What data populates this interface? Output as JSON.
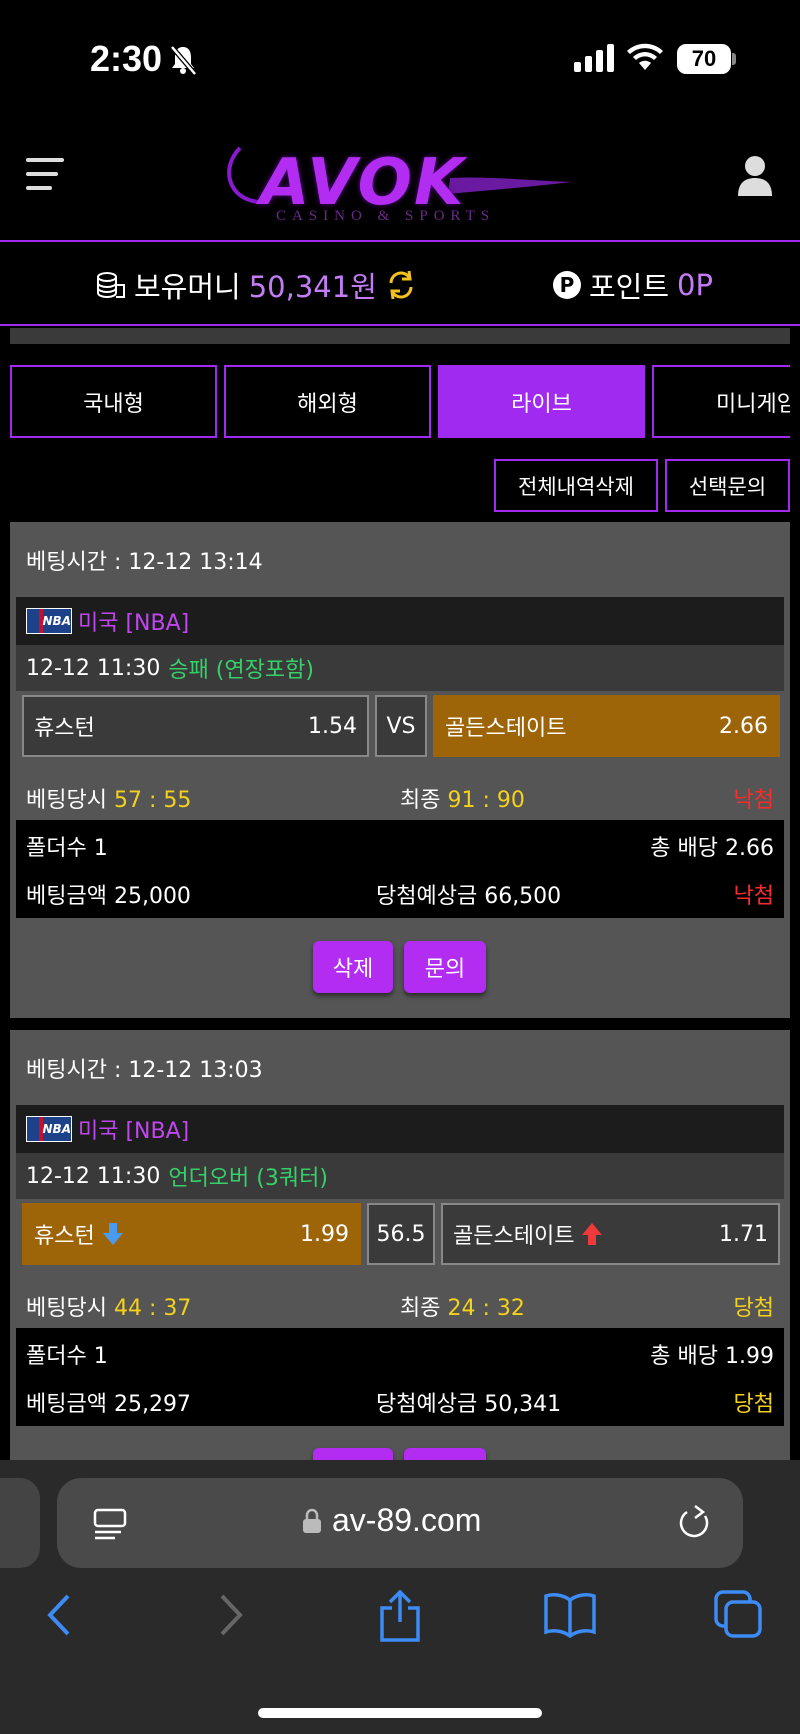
{
  "status_bar": {
    "time": "2:30",
    "battery": "70"
  },
  "header": {
    "logo_text": "AVOK",
    "logo_sub": "CASINO & SPORTS"
  },
  "money_bar": {
    "money_label": "보유머니",
    "money_value": "50,341원",
    "point_badge": "P",
    "point_label": "포인트",
    "point_value": "0P"
  },
  "tabs": [
    {
      "label": "국내형"
    },
    {
      "label": "해외형"
    },
    {
      "label": "라이브",
      "active": true
    },
    {
      "label": "미니게임"
    }
  ],
  "actions": {
    "delete_all": "전체내역삭제",
    "inquire_selected": "선택문의"
  },
  "bets": [
    {
      "bet_time": "베팅시간 : 12-12 13:14",
      "league": "미국 [NBA]",
      "game_time": "12-12 11:30",
      "bet_type": "승패 (연장포함)",
      "home_team": "휴스턴",
      "home_odds": "1.54",
      "middle": "VS",
      "away_team": "골든스테이트",
      "away_odds": "2.66",
      "score_label": "베팅당시",
      "score_at_bet": "57 : 55",
      "final_label": "최종",
      "final_score": "91 : 90",
      "result": "낙첨",
      "folder_count": "폴더수 1",
      "total_odds": "총 배당 2.66",
      "bet_amount": "베팅금액 25,000",
      "expected_win": "당첨예상금 66,500",
      "result2": "낙첨",
      "delete_label": "삭제",
      "inquire_label": "문의"
    },
    {
      "bet_time": "베팅시간 : 12-12 13:03",
      "league": "미국 [NBA]",
      "game_time": "12-12 11:30",
      "bet_type": "언더오버 (3쿼터)",
      "home_team": "휴스턴",
      "home_odds": "1.99",
      "middle": "56.5",
      "away_team": "골든스테이트",
      "away_odds": "1.71",
      "score_label": "베팅당시",
      "score_at_bet": "44 : 37",
      "final_label": "최종",
      "final_score": "24 : 32",
      "result": "당첨",
      "folder_count": "폴더수 1",
      "total_odds": "총 배당 1.99",
      "bet_amount": "베팅금액 25,297",
      "expected_win": "당첨예상금 50,341",
      "result2": "당첨"
    }
  ],
  "browser": {
    "url": "av-89.com"
  },
  "colors": {
    "accent": "#a12af0",
    "selected_odd": "#9e6508",
    "win": "#f4d21c",
    "lose": "#ff2a2a",
    "bet_type": "#36d06b"
  }
}
